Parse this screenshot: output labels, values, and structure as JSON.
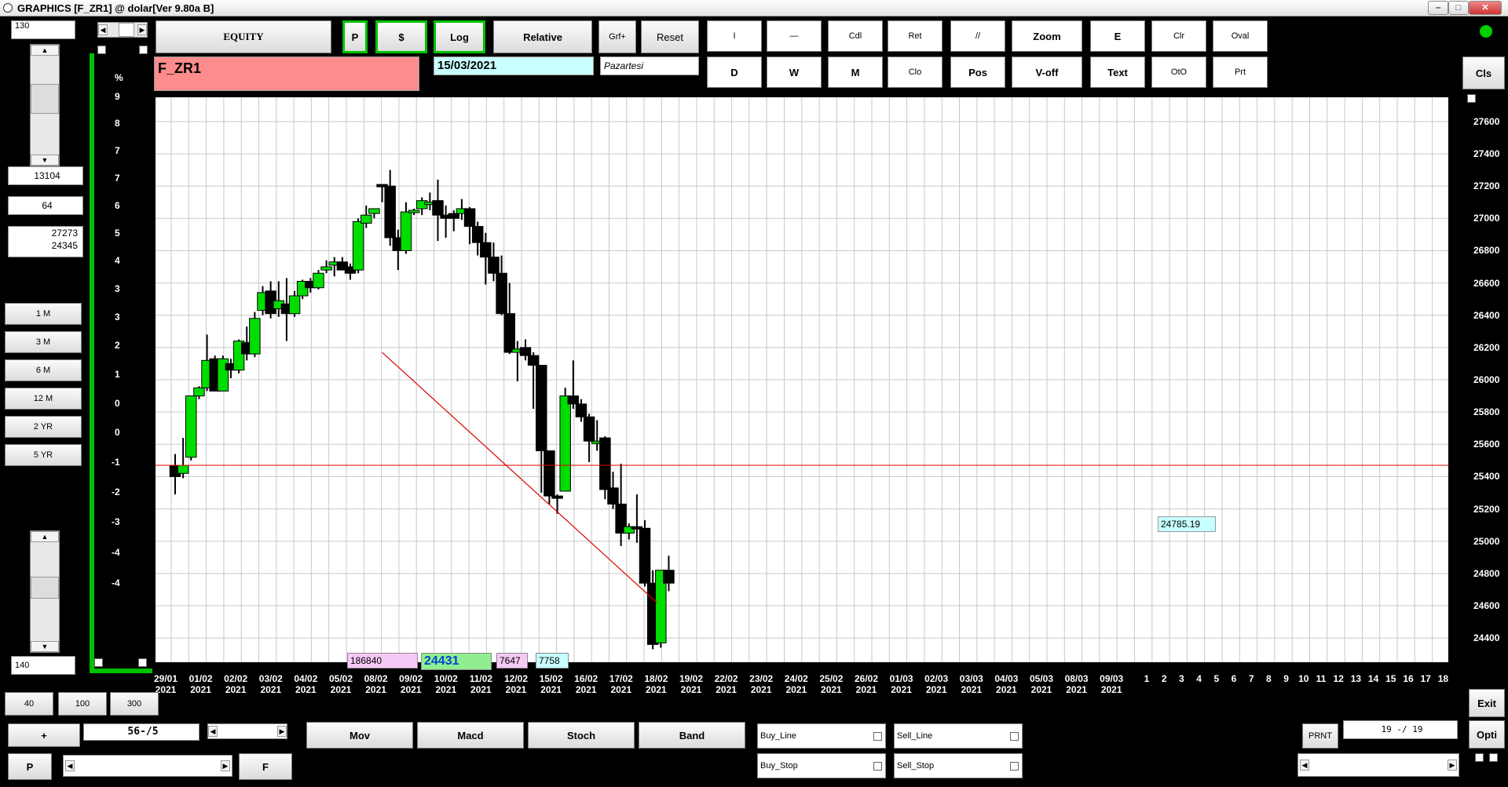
{
  "window": {
    "title": "GRAPHICS  [F_ZR1] @ dolar[Ver 9.80a B]"
  },
  "left": {
    "top_value": "130",
    "bottom_value": "140",
    "count": "13104",
    "period": "64",
    "range_high": "27273",
    "range_low": "24345",
    "timeframes": [
      "1 M",
      "3 M",
      "6 M",
      "12 M",
      "2 YR",
      "5 YR"
    ]
  },
  "toolbar": {
    "equity": "EQUITY",
    "p": "P",
    "dollar": "$",
    "log": "Log",
    "relative": "Relative",
    "grf_plus": "Grf+",
    "reset": "Reset",
    "row1": [
      "I",
      "—",
      "Cdl",
      "Ret",
      "//",
      "Zoom",
      "E",
      "Clr",
      "Oval"
    ],
    "row2": [
      "D",
      "W",
      "M",
      "Clo",
      "Pos",
      "V-off",
      "Text",
      "OtO",
      "Prt"
    ],
    "cls": "Cls"
  },
  "symbol": "F_ZR1",
  "date": "15/03/2021",
  "day": "Pazartesi",
  "pct_label": "%",
  "price_box": "24785.19",
  "info_boxes": [
    "186840",
    "24431",
    "7647",
    "7758"
  ],
  "bottom": {
    "b40": "40",
    "b100": "100",
    "b300": "300",
    "plus": "+",
    "ratio": "56-/5",
    "p": "P",
    "f": "F",
    "indicators": [
      "Mov",
      "Macd",
      "Stoch",
      "Band"
    ],
    "buy_line": "Buy_Line",
    "sell_line": "Sell_Line",
    "buy_stop": "Buy_Stop",
    "sell_stop": "Sell_Stop",
    "prnt": "PRNT",
    "page": "19 -/ 19",
    "exit": "Exit",
    "opti": "Opti"
  },
  "colors": {
    "up": "#00dd00",
    "down": "#000000",
    "trend": "#e00000",
    "grid": "#c8c8c8",
    "symbol_bg": "#ff8c8c",
    "date_bg": "#c8ffff",
    "accent_green": "#00c000"
  },
  "chart_data": {
    "type": "candlestick",
    "y_right_ticks": [
      27600,
      27400,
      27200,
      27000,
      26800,
      26600,
      26400,
      26200,
      26000,
      25800,
      25600,
      25400,
      25200,
      25000,
      24800,
      24600,
      24400
    ],
    "y_left_ticks": [
      "9",
      "8",
      "7",
      "7",
      "6",
      "5",
      "4",
      "3",
      "3",
      "2",
      "1",
      "0",
      "0",
      "-1",
      "-2",
      "-3",
      "-4",
      "-4"
    ],
    "x_ticks": [
      [
        "29/01",
        "2021"
      ],
      [
        "01/02",
        "2021"
      ],
      [
        "02/02",
        "2021"
      ],
      [
        "03/02",
        "2021"
      ],
      [
        "04/02",
        "2021"
      ],
      [
        "05/02",
        "2021"
      ],
      [
        "08/02",
        "2021"
      ],
      [
        "09/02",
        "2021"
      ],
      [
        "10/02",
        "2021"
      ],
      [
        "11/02",
        "2021"
      ],
      [
        "12/02",
        "2021"
      ],
      [
        "15/02",
        "2021"
      ],
      [
        "16/02",
        "2021"
      ],
      [
        "17/02",
        "2021"
      ],
      [
        "18/02",
        "2021"
      ],
      [
        "19/02",
        "2021"
      ],
      [
        "22/02",
        "2021"
      ],
      [
        "23/02",
        "2021"
      ],
      [
        "24/02",
        "2021"
      ],
      [
        "25/02",
        "2021"
      ],
      [
        "26/02",
        "2021"
      ],
      [
        "01/03",
        "2021"
      ],
      [
        "02/03",
        "2021"
      ],
      [
        "03/03",
        "2021"
      ],
      [
        "04/03",
        "2021"
      ],
      [
        "05/03",
        "2021"
      ],
      [
        "08/03",
        "2021"
      ],
      [
        "09/03",
        "2021"
      ],
      [
        "1",
        ""
      ],
      [
        "2",
        ""
      ],
      [
        "3",
        ""
      ],
      [
        "4",
        ""
      ],
      [
        "5",
        ""
      ],
      [
        "6",
        ""
      ],
      [
        "7",
        ""
      ],
      [
        "8",
        ""
      ],
      [
        "9",
        ""
      ],
      [
        "10",
        ""
      ],
      [
        "11",
        ""
      ],
      [
        "12",
        ""
      ],
      [
        "13",
        ""
      ],
      [
        "14",
        ""
      ],
      [
        "15",
        ""
      ],
      [
        "16",
        ""
      ],
      [
        "17",
        ""
      ],
      [
        "18",
        ""
      ]
    ],
    "ylim": [
      24250,
      27750
    ],
    "reference_line": 25470,
    "trendline": [
      [
        26,
        26170
      ],
      [
        60.5,
        24620
      ]
    ],
    "candles": [
      [
        25470,
        25540,
        25290,
        25400
      ],
      [
        25420,
        25640,
        25390,
        25470
      ],
      [
        25520,
        25900,
        25500,
        25900
      ],
      [
        25900,
        25960,
        25880,
        25950
      ],
      [
        25950,
        26280,
        25930,
        26120
      ],
      [
        26130,
        26150,
        25940,
        25930
      ],
      [
        25930,
        26150,
        25930,
        26130
      ],
      [
        26100,
        26130,
        26010,
        26060
      ],
      [
        26060,
        26250,
        26040,
        26240
      ],
      [
        26230,
        26330,
        26120,
        26160
      ],
      [
        26160,
        26420,
        26140,
        26380
      ],
      [
        26430,
        26580,
        26400,
        26540
      ],
      [
        26550,
        26610,
        26380,
        26410
      ],
      [
        26440,
        26610,
        26390,
        26490
      ],
      [
        26470,
        26630,
        26240,
        26410
      ],
      [
        26410,
        26550,
        26390,
        26520
      ],
      [
        26520,
        26620,
        26500,
        26610
      ],
      [
        26610,
        26630,
        26540,
        26570
      ],
      [
        26570,
        26680,
        26560,
        26660
      ],
      [
        26680,
        26740,
        26660,
        26700
      ],
      [
        26710,
        26760,
        26640,
        26730
      ],
      [
        26730,
        26760,
        26680,
        26680
      ],
      [
        26700,
        26720,
        26620,
        26660
      ],
      [
        26680,
        27000,
        26660,
        26980
      ],
      [
        26970,
        27080,
        26940,
        27020
      ],
      [
        27030,
        27060,
        27000,
        27060
      ],
      [
        27210,
        27210,
        27100,
        27200
      ],
      [
        27200,
        27300,
        26830,
        26880
      ],
      [
        26880,
        26930,
        26680,
        26800
      ],
      [
        26800,
        27100,
        26780,
        27040
      ],
      [
        27050,
        27060,
        27020,
        27050
      ],
      [
        27060,
        27130,
        27020,
        27110
      ],
      [
        27100,
        27160,
        27050,
        27100
      ],
      [
        27110,
        27240,
        26860,
        27020
      ],
      [
        27020,
        27080,
        26880,
        27000
      ],
      [
        27030,
        27050,
        26920,
        27000
      ],
      [
        27030,
        27120,
        26990,
        27060
      ],
      [
        27060,
        27070,
        26840,
        26950
      ],
      [
        26950,
        26980,
        26770,
        26850
      ],
      [
        26850,
        26910,
        26590,
        26760
      ],
      [
        26760,
        26850,
        26610,
        26660
      ],
      [
        26660,
        26770,
        26400,
        26410
      ],
      [
        26410,
        26600,
        26160,
        26170
      ],
      [
        26170,
        26240,
        25990,
        26190
      ],
      [
        26200,
        26250,
        26120,
        26150
      ],
      [
        26150,
        26170,
        25820,
        26090
      ],
      [
        26090,
        26090,
        25300,
        25560
      ],
      [
        25560,
        25560,
        25230,
        25280
      ],
      [
        25280,
        25290,
        25170,
        25270
      ],
      [
        25310,
        25950,
        25310,
        25900
      ],
      [
        25900,
        26120,
        25820,
        25850
      ],
      [
        25850,
        25880,
        25740,
        25770
      ],
      [
        25770,
        25790,
        25490,
        25620
      ],
      [
        25620,
        25750,
        25560,
        25620
      ],
      [
        25640,
        25650,
        25260,
        25320
      ],
      [
        25330,
        25430,
        25200,
        25230
      ],
      [
        25230,
        25480,
        24970,
        25050
      ],
      [
        25050,
        25110,
        25010,
        25090
      ],
      [
        25090,
        25290,
        24990,
        25080
      ],
      [
        25080,
        25130,
        24720,
        24740
      ],
      [
        24740,
        24820,
        24330,
        24360
      ],
      [
        24370,
        24820,
        24340,
        24820
      ],
      [
        24820,
        24910,
        24690,
        24740
      ]
    ]
  }
}
